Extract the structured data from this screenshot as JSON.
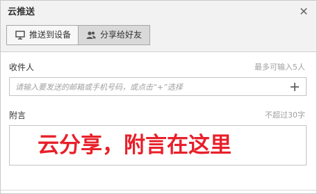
{
  "dialog": {
    "title": "云推送",
    "close_icon": "close-icon"
  },
  "tabs": [
    {
      "label": "推送到设备",
      "icon": "monitor-icon",
      "selected": false
    },
    {
      "label": "分享给好友",
      "icon": "users-icon",
      "selected": true
    }
  ],
  "recipient": {
    "label": "收件人",
    "hint": "最多可输入5人",
    "placeholder": "请输入要发送的邮箱或手机号码，或点击“+”选择",
    "value": "",
    "add_icon": "plus-icon"
  },
  "note": {
    "label": "附言",
    "hint": "不超过30字",
    "text": "云分享，附言在这里",
    "text_color": "#e8202a"
  },
  "colors": {
    "titlebar_bg": "#f2f2f2",
    "selected_tab_bg": "#d9d9d9",
    "accent_red": "#e8202a"
  }
}
